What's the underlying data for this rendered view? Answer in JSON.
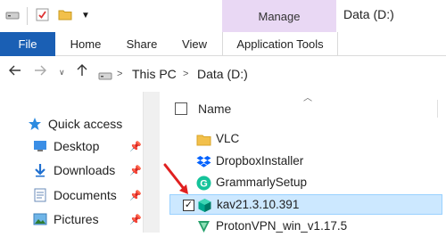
{
  "titlebar": {
    "manage_label": "Manage",
    "window_title": "Data (D:)"
  },
  "ribbon": {
    "tabs": [
      "File",
      "Home",
      "Share",
      "View"
    ],
    "context_tab": "Application Tools"
  },
  "address": {
    "crumbs": [
      "This PC",
      "Data (D:)"
    ],
    "separator": ">"
  },
  "navigation": {
    "quick_access": "Quick access",
    "items": [
      {
        "label": "Desktop",
        "icon": "desktop-icon",
        "pinned": true
      },
      {
        "label": "Downloads",
        "icon": "download-arrow-icon",
        "pinned": true
      },
      {
        "label": "Documents",
        "icon": "documents-icon",
        "pinned": true
      },
      {
        "label": "Pictures",
        "icon": "pictures-icon",
        "pinned": true
      }
    ]
  },
  "filelist": {
    "column_name": "Name",
    "files": [
      {
        "name": "VLC",
        "icon": "folder-icon"
      },
      {
        "name": "DropboxInstaller",
        "icon": "dropbox-icon"
      },
      {
        "name": "GrammarlySetup",
        "icon": "grammarly-icon"
      },
      {
        "name": "kav21.3.10.391",
        "icon": "kaspersky-icon",
        "selected": true,
        "checked": true
      },
      {
        "name": "ProtonVPN_win_v1.17.5",
        "icon": "protonvpn-icon"
      }
    ]
  },
  "colors": {
    "file_tab": "#1a5fb4",
    "manage_tab": "#e9d8f4",
    "selection": "#cce8ff",
    "annotation_arrow": "#e02020"
  }
}
